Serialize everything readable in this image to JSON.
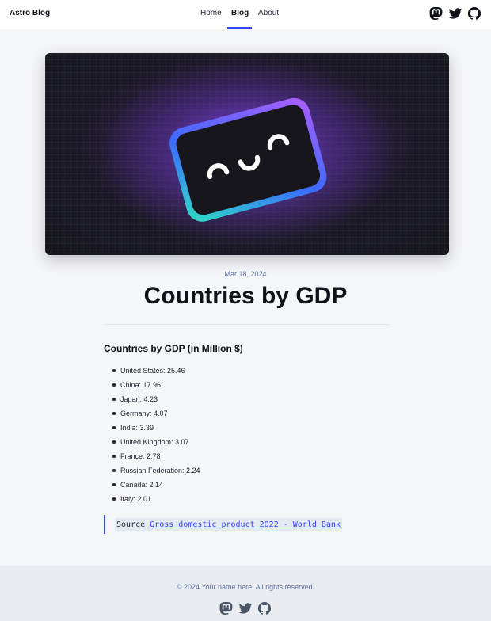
{
  "header": {
    "brand": "Astro Blog",
    "nav": [
      {
        "label": "Home",
        "active": false
      },
      {
        "label": "Blog",
        "active": true
      },
      {
        "label": "About",
        "active": false
      }
    ],
    "social_icons": [
      "mastodon-icon",
      "twitter-icon",
      "github-icon"
    ]
  },
  "post": {
    "date": "Mar 18, 2024",
    "title": "Countries by GDP",
    "subheading": "Countries by GDP (in Million $)",
    "items": [
      "United States: 25.46",
      "China: 17.96",
      "Japan: 4.23",
      "Germany: 4.07",
      "India: 3.39",
      "United Kingdom: 3.07",
      "France: 2.78",
      "Russian Federation: 2.24",
      "Canada: 2.14",
      "Italy: 2.01"
    ],
    "source_prefix": "Source ",
    "source_link": "Gross domestic product 2022 - World Bank"
  },
  "footer": {
    "copyright": "© 2024 Your name here. All rights reserved.",
    "social_icons": [
      "mastodon-icon",
      "twitter-icon",
      "github-icon"
    ]
  },
  "colors": {
    "accent": "#3245ff",
    "text": "#0f1219",
    "muted": "#60739f",
    "background": "#f3f4f6"
  }
}
